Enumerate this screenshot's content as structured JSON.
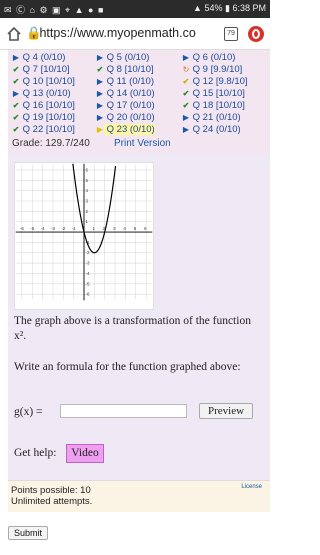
{
  "status_bar": {
    "left_icons": "✉ Ⓒ ⌂ ⚙ ▣ ⌖ ▲ ● ■",
    "battery": "54%",
    "time": "6:38 PM"
  },
  "browser": {
    "url": "https://www.myopenmath.co",
    "tab_count": "79"
  },
  "questions": {
    "rows": [
      [
        {
          "mark": "arrow",
          "label": "Q 4 (0/10)"
        },
        {
          "mark": "arrow",
          "label": "Q 5 (0/10)"
        },
        {
          "mark": "arrow",
          "label": "Q 6 (0/10)"
        }
      ],
      [
        {
          "mark": "check",
          "label": "Q 7 [10/10]"
        },
        {
          "mark": "check",
          "label": "Q 8 [10/10]"
        },
        {
          "mark": "retry",
          "label": "Q 9 [9.9/10]"
        }
      ],
      [
        {
          "mark": "check",
          "label": "Q 10 [10/10]"
        },
        {
          "mark": "arrow",
          "label": "Q 11 (0/10)"
        },
        {
          "mark": "partial",
          "label": "Q 12 [9.8/10]"
        }
      ],
      [
        {
          "mark": "arrow",
          "label": "Q 13 (0/10)"
        },
        {
          "mark": "arrow",
          "label": "Q 14 (0/10)"
        },
        {
          "mark": "check",
          "label": "Q 15 [10/10]"
        }
      ],
      [
        {
          "mark": "check",
          "label": "Q 16 [10/10]"
        },
        {
          "mark": "arrow",
          "label": "Q 17 (0/10)"
        },
        {
          "mark": "check",
          "label": "Q 18 [10/10]"
        }
      ],
      [
        {
          "mark": "check",
          "label": "Q 19 [10/10]"
        },
        {
          "mark": "arrow",
          "label": "Q 20 (0/10)"
        },
        {
          "mark": "arrow",
          "label": "Q 21 (0/10)"
        }
      ],
      [
        {
          "mark": "check",
          "label": "Q 22 [10/10]"
        },
        {
          "mark": "curarrow",
          "label": "Q 23 (0/10)",
          "current": true
        },
        {
          "mark": "arrow",
          "label": "Q 24 (0/10)"
        }
      ]
    ],
    "grade": "Grade: 129.7/240",
    "print_version": "Print Version"
  },
  "graph": {
    "x_ticks": [
      "-6",
      "-5",
      "-4",
      "-3",
      "-2",
      "-1",
      "1",
      "2",
      "3",
      "4",
      "5",
      "6"
    ],
    "y_ticks": [
      "6",
      "5",
      "4",
      "3",
      "2",
      "1",
      "-1",
      "-2",
      "-3",
      "-4",
      "-5",
      "-6"
    ]
  },
  "question": {
    "text1": "The graph above is a transformation of the function x².",
    "text2": "Write an formula for the function graphed above:",
    "answer_label": "g(x) =",
    "answer_value": "",
    "preview": "Preview",
    "help_label": "Get help:",
    "video": "Video"
  },
  "footer": {
    "points": "Points possible: 10",
    "attempts": "Unlimited attempts.",
    "license": "License"
  },
  "submit": "Submit"
}
